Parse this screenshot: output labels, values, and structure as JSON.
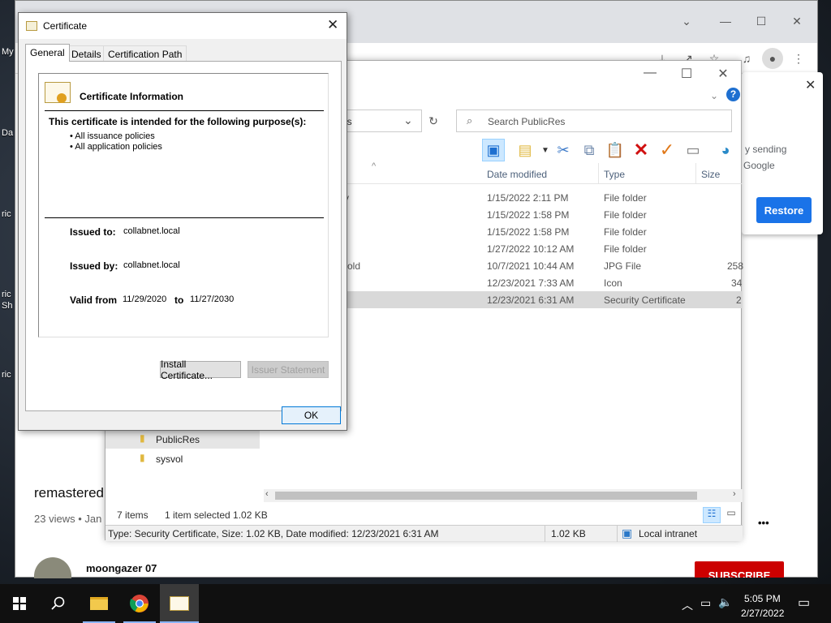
{
  "desktop": {
    "icons": [
      {
        "label": "My"
      },
      {
        "label": "Da"
      },
      {
        "label": "ric"
      },
      {
        "label": "ric Sh"
      },
      {
        "label": "ric"
      }
    ]
  },
  "chrome": {
    "bookmark_partial": "My",
    "restore_card": {
      "line1": "y sending",
      "line2": "Google",
      "button": "Restore"
    },
    "video_title": "remastered",
    "video_meta": "23 views • Jan",
    "channel": "moongazer 07",
    "subscribe": "SUBSCRIBE",
    "more": "•••"
  },
  "explorer": {
    "address_partial": "es",
    "search_placeholder": "Search PublicRes",
    "columns": {
      "date": "Date modified",
      "type": "Type",
      "size": "Size"
    },
    "rows": [
      {
        "name": "y",
        "date": "1/15/2022 2:11 PM",
        "type": "File folder",
        "size": ""
      },
      {
        "name": "",
        "date": "1/15/2022 1:58 PM",
        "type": "File folder",
        "size": ""
      },
      {
        "name": "",
        "date": "1/15/2022 1:58 PM",
        "type": "File folder",
        "size": ""
      },
      {
        "name": "",
        "date": "1/27/2022 10:12 AM",
        "type": "File folder",
        "size": ""
      },
      {
        "name": "old",
        "date": "10/7/2021 10:44 AM",
        "type": "JPG File",
        "size": "258"
      },
      {
        "name": "",
        "date": "12/23/2021 7:33 AM",
        "type": "Icon",
        "size": "34"
      },
      {
        "name": "",
        "date": "12/23/2021 6:31 AM",
        "type": "Security Certificate",
        "size": "2"
      }
    ],
    "nav": [
      {
        "label": "PublicRes"
      },
      {
        "label": "sysvol"
      }
    ],
    "status": {
      "items": "7 items",
      "selected": "1 item selected  1.02 KB"
    },
    "detail": {
      "info": "Type: Security Certificate, Size: 1.02 KB, Date modified: 12/23/2021 6:31 AM",
      "size": "1.02 KB",
      "zone": "Local intranet"
    }
  },
  "cert": {
    "title": "Certificate",
    "tabs": [
      {
        "label": "General"
      },
      {
        "label": "Details"
      },
      {
        "label": "Certification Path"
      }
    ],
    "heading": "Certificate Information",
    "purpose_heading": "This certificate is intended for the following purpose(s):",
    "purposes": [
      "• All issuance policies",
      "• All application policies"
    ],
    "issued_to_label": "Issued to:",
    "issued_to": "collabnet.local",
    "issued_by_label": "Issued by:",
    "issued_by": "collabnet.local",
    "valid_from_label": "Valid from",
    "valid_from": "11/29/2020",
    "to_label": "to",
    "valid_to": "11/27/2030",
    "install_button": "Install Certificate...",
    "issuer_button": "Issuer Statement",
    "ok_button": "OK"
  },
  "taskbar": {
    "time": "5:05 PM",
    "date": "2/27/2022"
  },
  "colors": {
    "accent": "#1a73e8",
    "youtube_red": "#cc0000",
    "delete_red": "#d01010"
  }
}
